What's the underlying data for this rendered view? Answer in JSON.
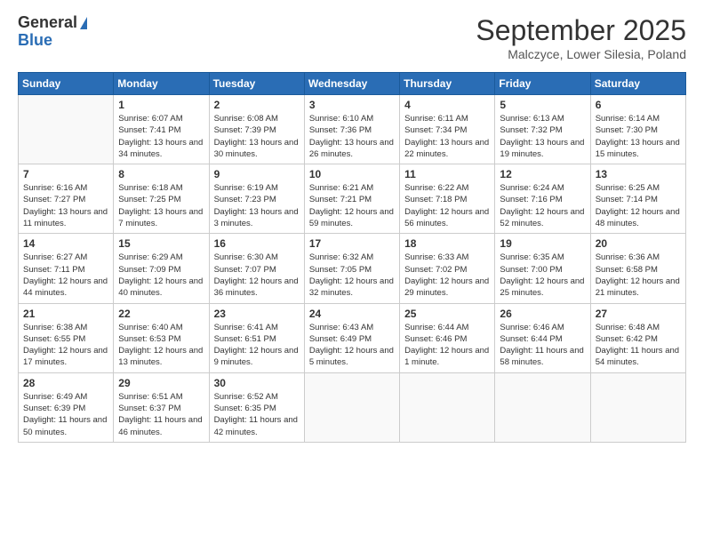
{
  "header": {
    "logo_general": "General",
    "logo_blue": "Blue",
    "month_title": "September 2025",
    "location": "Malczyce, Lower Silesia, Poland"
  },
  "weekdays": [
    "Sunday",
    "Monday",
    "Tuesday",
    "Wednesday",
    "Thursday",
    "Friday",
    "Saturday"
  ],
  "weeks": [
    [
      {
        "day": "",
        "sunrise": "",
        "sunset": "",
        "daylight": ""
      },
      {
        "day": "1",
        "sunrise": "Sunrise: 6:07 AM",
        "sunset": "Sunset: 7:41 PM",
        "daylight": "Daylight: 13 hours and 34 minutes."
      },
      {
        "day": "2",
        "sunrise": "Sunrise: 6:08 AM",
        "sunset": "Sunset: 7:39 PM",
        "daylight": "Daylight: 13 hours and 30 minutes."
      },
      {
        "day": "3",
        "sunrise": "Sunrise: 6:10 AM",
        "sunset": "Sunset: 7:36 PM",
        "daylight": "Daylight: 13 hours and 26 minutes."
      },
      {
        "day": "4",
        "sunrise": "Sunrise: 6:11 AM",
        "sunset": "Sunset: 7:34 PM",
        "daylight": "Daylight: 13 hours and 22 minutes."
      },
      {
        "day": "5",
        "sunrise": "Sunrise: 6:13 AM",
        "sunset": "Sunset: 7:32 PM",
        "daylight": "Daylight: 13 hours and 19 minutes."
      },
      {
        "day": "6",
        "sunrise": "Sunrise: 6:14 AM",
        "sunset": "Sunset: 7:30 PM",
        "daylight": "Daylight: 13 hours and 15 minutes."
      }
    ],
    [
      {
        "day": "7",
        "sunrise": "Sunrise: 6:16 AM",
        "sunset": "Sunset: 7:27 PM",
        "daylight": "Daylight: 13 hours and 11 minutes."
      },
      {
        "day": "8",
        "sunrise": "Sunrise: 6:18 AM",
        "sunset": "Sunset: 7:25 PM",
        "daylight": "Daylight: 13 hours and 7 minutes."
      },
      {
        "day": "9",
        "sunrise": "Sunrise: 6:19 AM",
        "sunset": "Sunset: 7:23 PM",
        "daylight": "Daylight: 13 hours and 3 minutes."
      },
      {
        "day": "10",
        "sunrise": "Sunrise: 6:21 AM",
        "sunset": "Sunset: 7:21 PM",
        "daylight": "Daylight: 12 hours and 59 minutes."
      },
      {
        "day": "11",
        "sunrise": "Sunrise: 6:22 AM",
        "sunset": "Sunset: 7:18 PM",
        "daylight": "Daylight: 12 hours and 56 minutes."
      },
      {
        "day": "12",
        "sunrise": "Sunrise: 6:24 AM",
        "sunset": "Sunset: 7:16 PM",
        "daylight": "Daylight: 12 hours and 52 minutes."
      },
      {
        "day": "13",
        "sunrise": "Sunrise: 6:25 AM",
        "sunset": "Sunset: 7:14 PM",
        "daylight": "Daylight: 12 hours and 48 minutes."
      }
    ],
    [
      {
        "day": "14",
        "sunrise": "Sunrise: 6:27 AM",
        "sunset": "Sunset: 7:11 PM",
        "daylight": "Daylight: 12 hours and 44 minutes."
      },
      {
        "day": "15",
        "sunrise": "Sunrise: 6:29 AM",
        "sunset": "Sunset: 7:09 PM",
        "daylight": "Daylight: 12 hours and 40 minutes."
      },
      {
        "day": "16",
        "sunrise": "Sunrise: 6:30 AM",
        "sunset": "Sunset: 7:07 PM",
        "daylight": "Daylight: 12 hours and 36 minutes."
      },
      {
        "day": "17",
        "sunrise": "Sunrise: 6:32 AM",
        "sunset": "Sunset: 7:05 PM",
        "daylight": "Daylight: 12 hours and 32 minutes."
      },
      {
        "day": "18",
        "sunrise": "Sunrise: 6:33 AM",
        "sunset": "Sunset: 7:02 PM",
        "daylight": "Daylight: 12 hours and 29 minutes."
      },
      {
        "day": "19",
        "sunrise": "Sunrise: 6:35 AM",
        "sunset": "Sunset: 7:00 PM",
        "daylight": "Daylight: 12 hours and 25 minutes."
      },
      {
        "day": "20",
        "sunrise": "Sunrise: 6:36 AM",
        "sunset": "Sunset: 6:58 PM",
        "daylight": "Daylight: 12 hours and 21 minutes."
      }
    ],
    [
      {
        "day": "21",
        "sunrise": "Sunrise: 6:38 AM",
        "sunset": "Sunset: 6:55 PM",
        "daylight": "Daylight: 12 hours and 17 minutes."
      },
      {
        "day": "22",
        "sunrise": "Sunrise: 6:40 AM",
        "sunset": "Sunset: 6:53 PM",
        "daylight": "Daylight: 12 hours and 13 minutes."
      },
      {
        "day": "23",
        "sunrise": "Sunrise: 6:41 AM",
        "sunset": "Sunset: 6:51 PM",
        "daylight": "Daylight: 12 hours and 9 minutes."
      },
      {
        "day": "24",
        "sunrise": "Sunrise: 6:43 AM",
        "sunset": "Sunset: 6:49 PM",
        "daylight": "Daylight: 12 hours and 5 minutes."
      },
      {
        "day": "25",
        "sunrise": "Sunrise: 6:44 AM",
        "sunset": "Sunset: 6:46 PM",
        "daylight": "Daylight: 12 hours and 1 minute."
      },
      {
        "day": "26",
        "sunrise": "Sunrise: 6:46 AM",
        "sunset": "Sunset: 6:44 PM",
        "daylight": "Daylight: 11 hours and 58 minutes."
      },
      {
        "day": "27",
        "sunrise": "Sunrise: 6:48 AM",
        "sunset": "Sunset: 6:42 PM",
        "daylight": "Daylight: 11 hours and 54 minutes."
      }
    ],
    [
      {
        "day": "28",
        "sunrise": "Sunrise: 6:49 AM",
        "sunset": "Sunset: 6:39 PM",
        "daylight": "Daylight: 11 hours and 50 minutes."
      },
      {
        "day": "29",
        "sunrise": "Sunrise: 6:51 AM",
        "sunset": "Sunset: 6:37 PM",
        "daylight": "Daylight: 11 hours and 46 minutes."
      },
      {
        "day": "30",
        "sunrise": "Sunrise: 6:52 AM",
        "sunset": "Sunset: 6:35 PM",
        "daylight": "Daylight: 11 hours and 42 minutes."
      },
      {
        "day": "",
        "sunrise": "",
        "sunset": "",
        "daylight": ""
      },
      {
        "day": "",
        "sunrise": "",
        "sunset": "",
        "daylight": ""
      },
      {
        "day": "",
        "sunrise": "",
        "sunset": "",
        "daylight": ""
      },
      {
        "day": "",
        "sunrise": "",
        "sunset": "",
        "daylight": ""
      }
    ]
  ]
}
